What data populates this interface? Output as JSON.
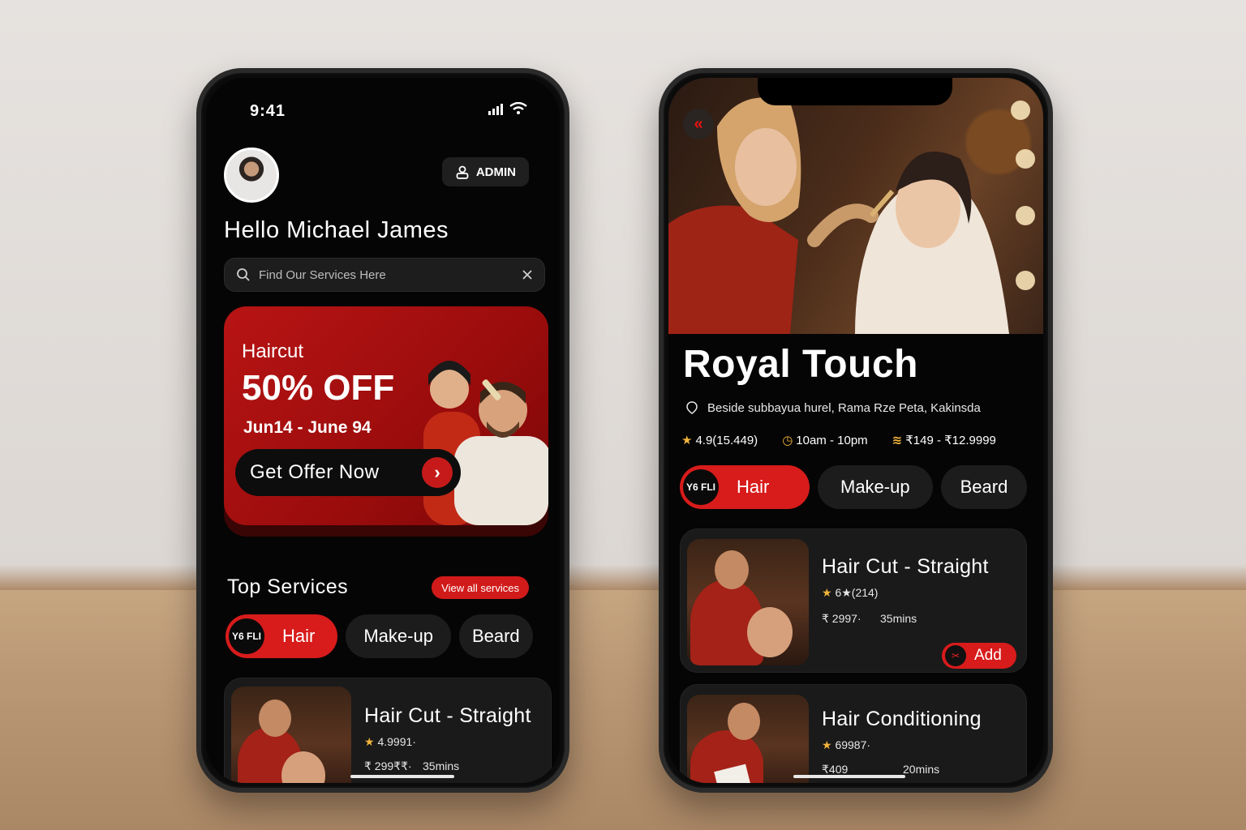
{
  "left_phone": {
    "status": {
      "time": "9:41"
    },
    "admin_label": "ADMIN",
    "greeting": "Hello Michael James",
    "search": {
      "placeholder": "Find Our Services Here"
    },
    "promo": {
      "kicker": "Haircut",
      "title": "50% OFF",
      "dates": "Jun14 - June 94",
      "cta": "Get Offer Now"
    },
    "top_services": {
      "title": "Top Services",
      "view_all": "View all services"
    },
    "categories": [
      {
        "label": "Hair",
        "logo": "Y6 FLI",
        "active": true
      },
      {
        "label": "Make-up",
        "active": false
      },
      {
        "label": "Beard",
        "active": false
      }
    ],
    "service_card": {
      "title": "Hair Cut - Straight",
      "rating": "4.9991·",
      "price": "₹ 299₹₹·",
      "duration": "35mins"
    }
  },
  "right_phone": {
    "salon_name": "Royal Touch",
    "address": "Beside subbayua hurel, Rama Rze Peta, Kakinsda",
    "rating": "4.9(15.449)",
    "hours": "10am - 10pm",
    "price_range": "₹149 - ₹12.9999",
    "categories": [
      {
        "label": "Hair",
        "logo": "Y6 FLI",
        "active": true
      },
      {
        "label": "Make-up",
        "active": false
      },
      {
        "label": "Beard",
        "active": false
      }
    ],
    "services": [
      {
        "title": "Hair Cut - Straight",
        "rating": "6★(214)",
        "price": "₹ 2997·",
        "duration": "35mins",
        "add_label": "Add"
      },
      {
        "title": "Hair Conditioning",
        "rating": "69987·",
        "price": "₹409",
        "duration": "20mins"
      }
    ]
  },
  "colors": {
    "accent": "#d81b1b",
    "background": "#050505",
    "card": "#1a1a1a",
    "star": "#f3b53b"
  }
}
